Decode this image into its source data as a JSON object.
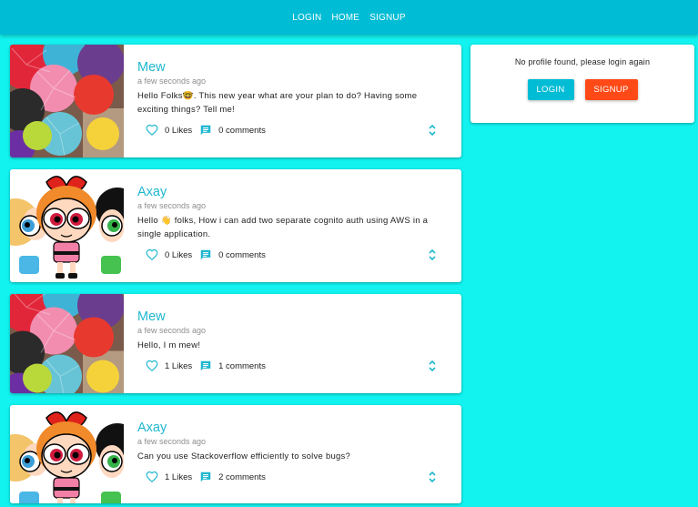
{
  "nav": {
    "login": "LOGIN",
    "home": "HOME",
    "signup": "SIGNUP"
  },
  "colors": {
    "navbar": "#00bcd4",
    "background": "#12f3f0",
    "accent": "#1fb7cf",
    "signup": "#ff4a17"
  },
  "posts": [
    {
      "author": "Mew",
      "time": "a few seconds ago",
      "body": "Hello Folks🤓. This new year what are your plan to do? Having some exciting things? Tell me!",
      "likes": "0 Likes",
      "comments": "0 comments",
      "image": "umbrellas"
    },
    {
      "author": "Axay",
      "time": "a few seconds ago",
      "body": "Hello 👋 folks, How i can add two separate cognito auth using AWS in a single application.",
      "likes": "0 Likes",
      "comments": "0 comments",
      "image": "powerpuff-girls"
    },
    {
      "author": "Mew",
      "time": "a few seconds ago",
      "body": "Hello, I m mew!",
      "likes": "1 Likes",
      "comments": "1 comments",
      "image": "umbrellas"
    },
    {
      "author": "Axay",
      "time": "a few seconds ago",
      "body": "Can you use Stackoverflow efficiently to solve bugs?",
      "likes": "1 Likes",
      "comments": "2 comments",
      "image": "powerpuff-girls"
    }
  ],
  "profile": {
    "message": "No profile found, please login again",
    "login": "LOGIN",
    "signup": "SIGNUP"
  },
  "icons": {
    "like": "heart-outline-icon",
    "comment": "comment-icon",
    "expand": "unfold-more-icon"
  }
}
